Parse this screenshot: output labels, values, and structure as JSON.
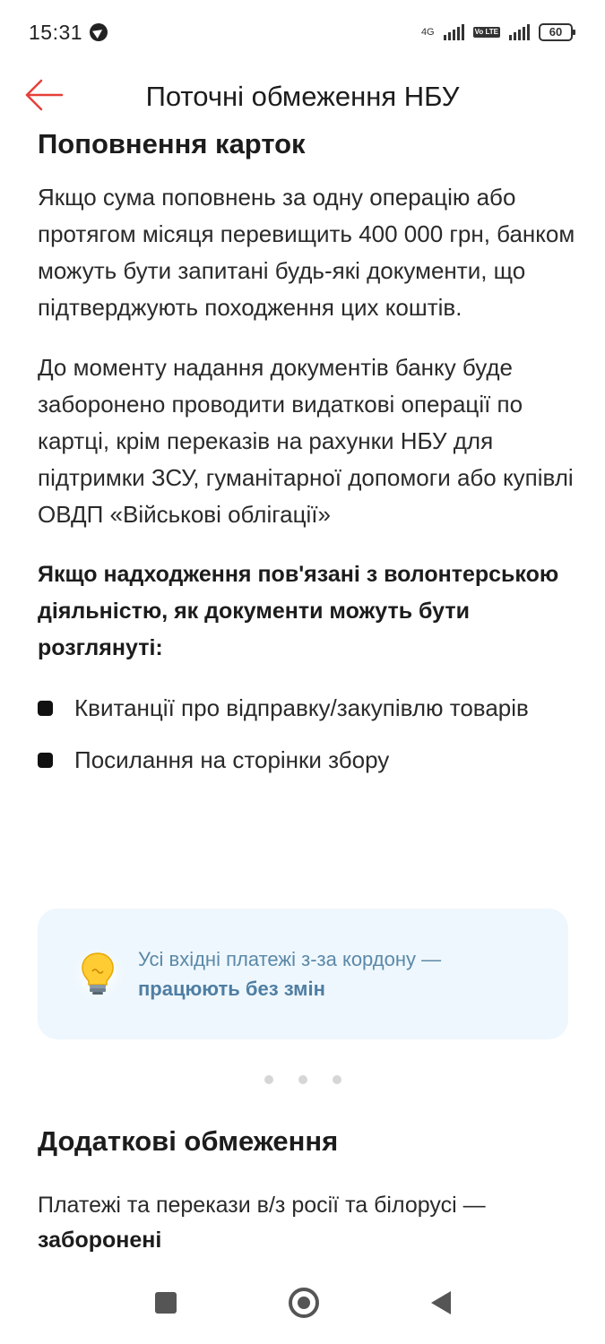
{
  "status_bar": {
    "time": "15:31",
    "network_label": "4G",
    "volte_label": "Vo LTE",
    "battery": "60"
  },
  "header": {
    "title": "Поточні обмеження НБУ"
  },
  "section1": {
    "heading": "Поповнення карток",
    "paragraph1": "Якщо сума поповнень за одну операцію або протягом місяця перевищить 400 000 грн, банком можуть бути запитані будь-які документи, що підтверджують походження цих коштів.",
    "paragraph2": "До моменту надання документів банку буде заборонено проводити видаткові операції по картці, крім переказів на рахунки НБУ для підтримки ЗСУ, гуманітарної допомоги або купівлі ОВДП «Військові облігації»",
    "bold_paragraph": "Якщо надходження пов'язані з волонтерською діяльністю, як документи можуть бути розглянуті:",
    "bullets": [
      {
        "text": "Квитанції про відправку/закупівлю товарів"
      },
      {
        "text": "Посилання на сторінки збору"
      }
    ]
  },
  "info_card": {
    "icon": "lightbulb-icon",
    "text": "Усі вхідні платежі з-за кордону —",
    "bold_text": "працюють без змін"
  },
  "pager": {
    "pages": 3
  },
  "section2": {
    "heading": "Додаткові обмеження",
    "text": "Платежі та перекази в/з росії та білорусі —",
    "bold_text": "заборонені"
  },
  "colors": {
    "accent": "#e5403a",
    "info_bg": "#eef7fd",
    "info_text": "#5b88a8"
  }
}
